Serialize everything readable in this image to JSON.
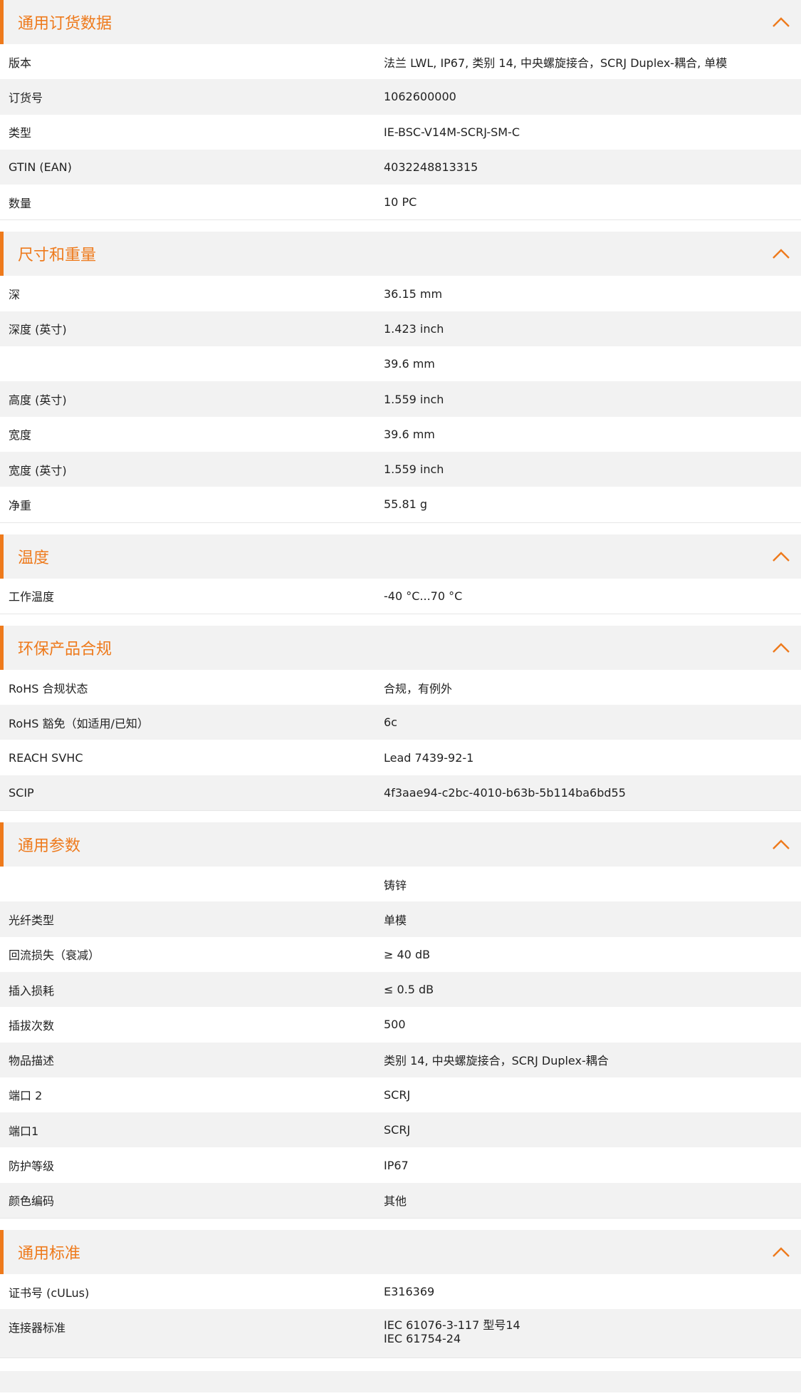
{
  "accent_color": "#ee7a1c",
  "collapse_icon": "chevron-up-icon",
  "sections": [
    {
      "title": "通用订货数据",
      "rows": [
        {
          "label": "版本",
          "value": "法兰 LWL, IP67, 类别 14, 中央螺旋接合，SCRJ Duplex-耦合, 单模"
        },
        {
          "label": "订货号",
          "value": "1062600000"
        },
        {
          "label": "类型",
          "value": "IE-BSC-V14M-SCRJ-SM-C"
        },
        {
          "label": "GTIN (EAN)",
          "value": "4032248813315"
        },
        {
          "label": "数量",
          "value": "10  PC"
        }
      ]
    },
    {
      "title": "尺寸和重量",
      "rows": [
        {
          "label": "深",
          "value": "36.15  mm"
        },
        {
          "label": "深度 (英寸)",
          "value": "1.423  inch"
        },
        {
          "label": "",
          "value": "39.6  mm"
        },
        {
          "label": "高度 (英寸)",
          "value": "1.559  inch"
        },
        {
          "label": "宽度",
          "value": "39.6  mm"
        },
        {
          "label": "宽度 (英寸)",
          "value": "1.559  inch"
        },
        {
          "label": "净重",
          "value": "55.81  g"
        }
      ]
    },
    {
      "title": "温度",
      "rows": [
        {
          "label": "工作温度",
          "value": "-40 °C...70 °C"
        }
      ]
    },
    {
      "title": "环保产品合规",
      "rows": [
        {
          "label": "RoHS 合规状态",
          "value": "合规，有例外"
        },
        {
          "label": "RoHS 豁免（如适用/已知）",
          "value": "6c"
        },
        {
          "label": "REACH SVHC",
          "value": "Lead 7439-92-1"
        },
        {
          "label": "SCIP",
          "value": "4f3aae94-c2bc-4010-b63b-5b114ba6bd55"
        }
      ]
    },
    {
      "title": "通用参数",
      "rows": [
        {
          "label": "",
          "value": "铸锌"
        },
        {
          "label": "光纤类型",
          "value": "单模"
        },
        {
          "label": "回流损失（衰减）",
          "value": "≥ 40 dB"
        },
        {
          "label": "插入损耗",
          "value": "≤ 0.5 dB"
        },
        {
          "label": "插拔次数",
          "value": "500"
        },
        {
          "label": "物品描述",
          "value": "类别 14, 中央螺旋接合，SCRJ Duplex-耦合"
        },
        {
          "label": "端口 2",
          "value": "SCRJ"
        },
        {
          "label": "端口1",
          "value": "SCRJ"
        },
        {
          "label": "防护等级",
          "value": "IP67"
        },
        {
          "label": "颜色编码",
          "value": "其他"
        }
      ]
    },
    {
      "title": "通用标准",
      "rows": [
        {
          "label": "证书号 (cULus)",
          "value": "E316369"
        },
        {
          "label": "连接器标准",
          "lines": [
            "IEC 61076-3-117 型号14",
            "IEC 61754-24"
          ]
        }
      ]
    }
  ]
}
